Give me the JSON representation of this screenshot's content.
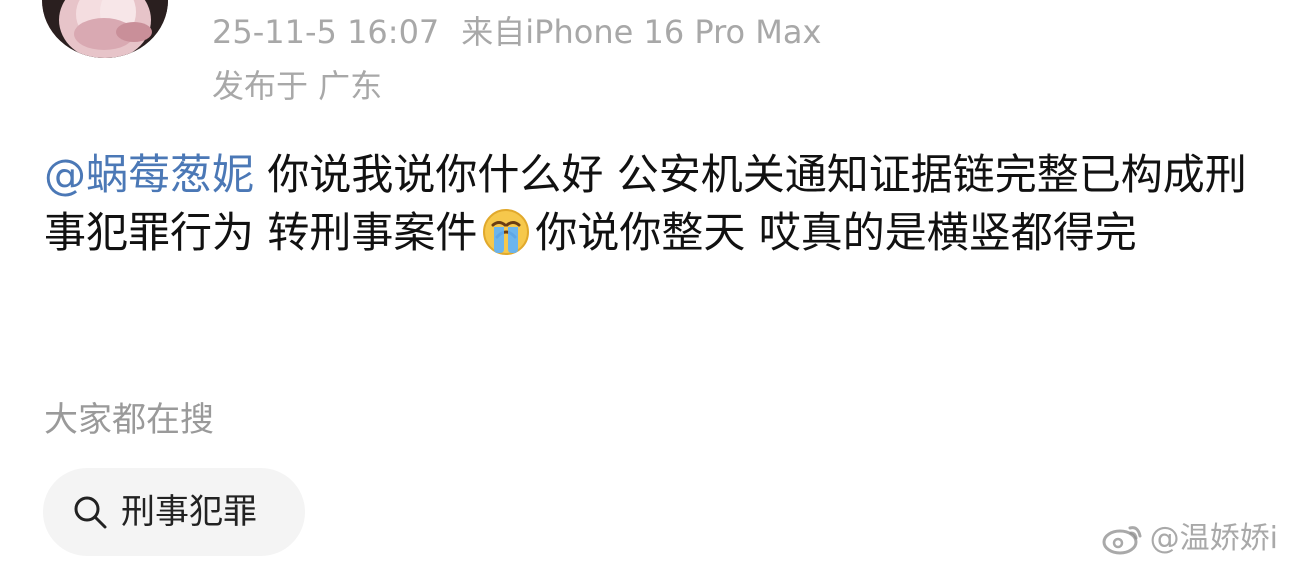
{
  "post": {
    "meta": {
      "time": "25-11-5 16:07",
      "source": "来自iPhone 16 Pro Max",
      "location": "发布于 广东"
    },
    "mention": "@蜗莓葱妮",
    "text_after_mention": " 你说我说你什么好 公安机关通知证据链完整已构成刑事犯罪行为 转刑事案件",
    "text_after_emoji": "你说你整天 哎真的是横竖都得完",
    "emoji": "crying-face"
  },
  "search": {
    "title": "大家都在搜",
    "chip_label": "刑事犯罪"
  },
  "watermark": {
    "text": "@温娇娇i"
  },
  "colors": {
    "mention": "#4b78b6",
    "meta_text": "#a8a8a8",
    "chip_bg": "#f4f4f4"
  }
}
